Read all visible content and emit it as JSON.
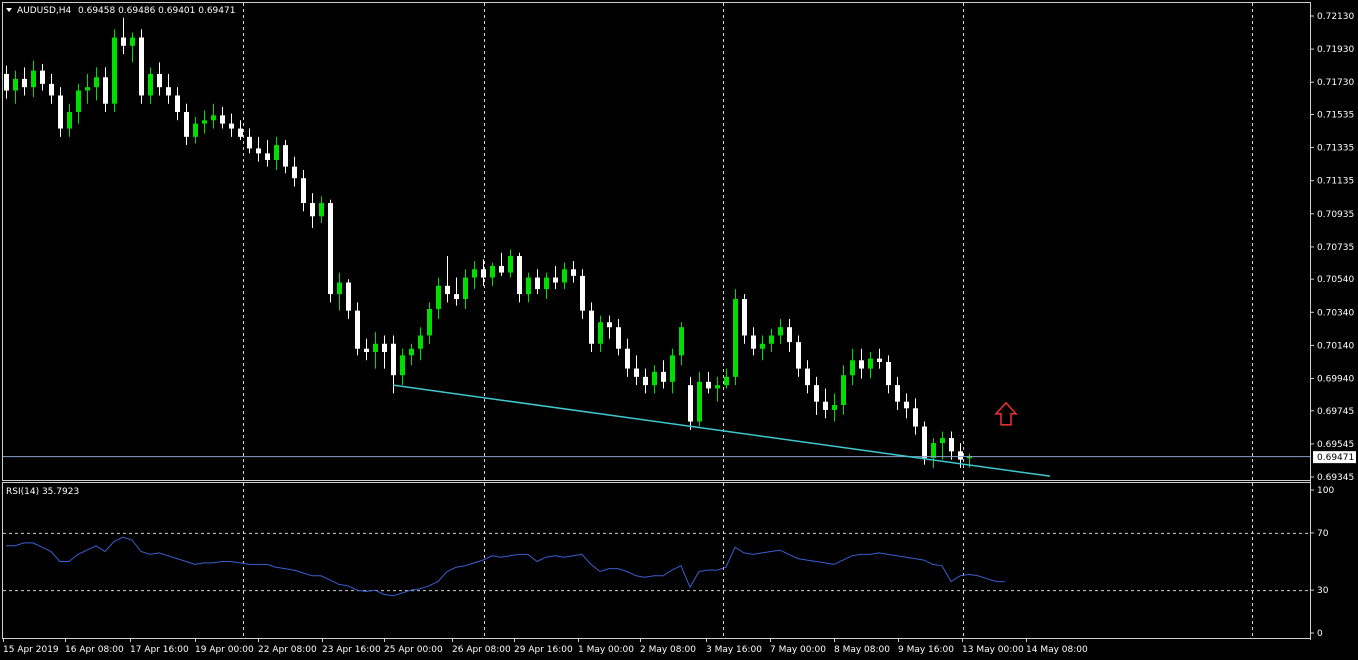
{
  "header": {
    "symbol": "AUDUSD,H4",
    "ohlc": "0.69458 0.69486 0.69401 0.69471"
  },
  "rsi_header": "RSI(14) 35.7923",
  "current_price_label": "0.69471",
  "colors": {
    "background": "#000000",
    "bull": "#00dd00",
    "bear": "#ffffff",
    "grid": "#ffffff",
    "trendline": "#40c8d0",
    "rsi_line": "#3a5fd0",
    "arrow": "#e03030",
    "price_line": "#8aa0c8"
  },
  "icons": {
    "signal_arrow": "up-arrow-icon",
    "collapse": "triangle-down-icon"
  },
  "price_axis_labels": [
    "0.72130",
    "0.71930",
    "0.71730",
    "0.71535",
    "0.71335",
    "0.71135",
    "0.70935",
    "0.70735",
    "0.70540",
    "0.70340",
    "0.70140",
    "0.69940",
    "0.69745",
    "0.69545",
    "0.69345"
  ],
  "rsi_axis_labels": [
    "100",
    "70",
    "30",
    "0"
  ],
  "time_axis_labels": [
    "15 Apr 2019",
    "16 Apr 08:00",
    "17 Apr 16:00",
    "19 Apr 00:00",
    "22 Apr 08:00",
    "23 Apr 16:00",
    "25 Apr 00:00",
    "26 Apr 08:00",
    "29 Apr 16:00",
    "1 May 00:00",
    "2 May 08:00",
    "3 May 16:00",
    "7 May 00:00",
    "8 May 08:00",
    "9 May 16:00",
    "13 May 00:00",
    "14 May 08:00"
  ],
  "chart_data": {
    "type": "candlestick",
    "symbol": "AUDUSD",
    "timeframe": "H4",
    "ylim": [
      0.69345,
      0.7213
    ],
    "current_price": 0.69471,
    "candles": [
      [
        0.7178,
        0.7183,
        0.7163,
        0.7168
      ],
      [
        0.7168,
        0.718,
        0.716,
        0.7175
      ],
      [
        0.7175,
        0.7182,
        0.7165,
        0.717
      ],
      [
        0.717,
        0.7186,
        0.7164,
        0.718
      ],
      [
        0.718,
        0.7184,
        0.7168,
        0.7172
      ],
      [
        0.7172,
        0.7178,
        0.716,
        0.7165
      ],
      [
        0.7165,
        0.717,
        0.714,
        0.7145
      ],
      [
        0.7145,
        0.716,
        0.714,
        0.7155
      ],
      [
        0.7155,
        0.7172,
        0.7148,
        0.7168
      ],
      [
        0.7168,
        0.7178,
        0.716,
        0.717
      ],
      [
        0.717,
        0.7182,
        0.7162,
        0.7176
      ],
      [
        0.7176,
        0.7182,
        0.7155,
        0.716
      ],
      [
        0.716,
        0.7205,
        0.7155,
        0.72
      ],
      [
        0.72,
        0.7212,
        0.719,
        0.7195
      ],
      [
        0.7195,
        0.7203,
        0.7185,
        0.72
      ],
      [
        0.72,
        0.7205,
        0.716,
        0.7165
      ],
      [
        0.7165,
        0.7182,
        0.716,
        0.7178
      ],
      [
        0.7178,
        0.7185,
        0.7165,
        0.717
      ],
      [
        0.717,
        0.7178,
        0.716,
        0.7165
      ],
      [
        0.7165,
        0.717,
        0.715,
        0.7155
      ],
      [
        0.7155,
        0.716,
        0.7135,
        0.714
      ],
      [
        0.714,
        0.7152,
        0.7136,
        0.7148
      ],
      [
        0.7148,
        0.7156,
        0.7142,
        0.715
      ],
      [
        0.715,
        0.716,
        0.7145,
        0.7153
      ],
      [
        0.7153,
        0.7158,
        0.7145,
        0.7148
      ],
      [
        0.7148,
        0.7154,
        0.714,
        0.7145
      ],
      [
        0.7145,
        0.715,
        0.7138,
        0.714
      ],
      [
        0.714,
        0.7145,
        0.713,
        0.7133
      ],
      [
        0.7133,
        0.714,
        0.7125,
        0.713
      ],
      [
        0.713,
        0.7138,
        0.7122,
        0.7126
      ],
      [
        0.7126,
        0.714,
        0.712,
        0.7135
      ],
      [
        0.7135,
        0.7138,
        0.7118,
        0.7122
      ],
      [
        0.7122,
        0.7128,
        0.711,
        0.7115
      ],
      [
        0.7115,
        0.712,
        0.7095,
        0.71
      ],
      [
        0.71,
        0.7106,
        0.7085,
        0.7092
      ],
      [
        0.7092,
        0.7104,
        0.7088,
        0.71
      ],
      [
        0.71,
        0.7102,
        0.704,
        0.7045
      ],
      [
        0.7045,
        0.7058,
        0.7035,
        0.7052
      ],
      [
        0.7052,
        0.7054,
        0.703,
        0.7035
      ],
      [
        0.7035,
        0.704,
        0.7008,
        0.7012
      ],
      [
        0.7012,
        0.7018,
        0.7005,
        0.701
      ],
      [
        0.701,
        0.7022,
        0.7,
        0.7015
      ],
      [
        0.7015,
        0.702,
        0.7,
        0.701
      ],
      [
        0.7015,
        0.702,
        0.6985,
        0.6996
      ],
      [
        0.6996,
        0.7012,
        0.699,
        0.7008
      ],
      [
        0.7008,
        0.7015,
        0.7002,
        0.7012
      ],
      [
        0.7012,
        0.7025,
        0.7005,
        0.702
      ],
      [
        0.702,
        0.704,
        0.7015,
        0.7036
      ],
      [
        0.7036,
        0.7055,
        0.703,
        0.705
      ],
      [
        0.705,
        0.7068,
        0.704,
        0.7045
      ],
      [
        0.7045,
        0.7055,
        0.7038,
        0.7042
      ],
      [
        0.7042,
        0.706,
        0.7036,
        0.7055
      ],
      [
        0.7055,
        0.7065,
        0.7048,
        0.706
      ],
      [
        0.706,
        0.7066,
        0.705,
        0.7055
      ],
      [
        0.7055,
        0.7064,
        0.705,
        0.7062
      ],
      [
        0.7062,
        0.707,
        0.7056,
        0.7058
      ],
      [
        0.7058,
        0.7072,
        0.7055,
        0.7068
      ],
      [
        0.7068,
        0.707,
        0.704,
        0.7045
      ],
      [
        0.7045,
        0.7058,
        0.704,
        0.7055
      ],
      [
        0.7055,
        0.706,
        0.7045,
        0.7048
      ],
      [
        0.7048,
        0.7058,
        0.7042,
        0.7055
      ],
      [
        0.7055,
        0.7062,
        0.7048,
        0.7052
      ],
      [
        0.7052,
        0.7064,
        0.7048,
        0.706
      ],
      [
        0.706,
        0.7065,
        0.7052,
        0.7056
      ],
      [
        0.7056,
        0.706,
        0.703,
        0.7035
      ],
      [
        0.7035,
        0.704,
        0.701,
        0.7015
      ],
      [
        0.7015,
        0.7032,
        0.701,
        0.7028
      ],
      [
        0.7028,
        0.7032,
        0.7018,
        0.7025
      ],
      [
        0.7025,
        0.703,
        0.7008,
        0.7012
      ],
      [
        0.7012,
        0.7018,
        0.6995,
        0.7
      ],
      [
        0.7,
        0.7008,
        0.699,
        0.6995
      ],
      [
        0.6995,
        0.7,
        0.6985,
        0.699
      ],
      [
        0.699,
        0.7002,
        0.6985,
        0.6998
      ],
      [
        0.6998,
        0.7005,
        0.6988,
        0.6992
      ],
      [
        0.6992,
        0.7012,
        0.6985,
        0.7008
      ],
      [
        0.7008,
        0.7028,
        0.7002,
        0.7025
      ],
      [
        0.699,
        0.6995,
        0.6963,
        0.6968
      ],
      [
        0.6968,
        0.6998,
        0.6965,
        0.6992
      ],
      [
        0.6992,
        0.6998,
        0.6985,
        0.6988
      ],
      [
        0.6988,
        0.6995,
        0.698,
        0.699
      ],
      [
        0.699,
        0.7,
        0.6988,
        0.6995
      ],
      [
        0.6995,
        0.7048,
        0.699,
        0.7042
      ],
      [
        0.7042,
        0.7045,
        0.7015,
        0.702
      ],
      [
        0.702,
        0.7025,
        0.7008,
        0.7012
      ],
      [
        0.7012,
        0.702,
        0.7005,
        0.7015
      ],
      [
        0.7015,
        0.7024,
        0.701,
        0.702
      ],
      [
        0.702,
        0.703,
        0.7015,
        0.7025
      ],
      [
        0.7025,
        0.703,
        0.701,
        0.7016
      ],
      [
        0.7016,
        0.702,
        0.6995,
        0.7
      ],
      [
        0.7,
        0.7005,
        0.6985,
        0.699
      ],
      [
        0.699,
        0.6995,
        0.6972,
        0.698
      ],
      [
        0.698,
        0.6988,
        0.697,
        0.6975
      ],
      [
        0.6975,
        0.6985,
        0.6968,
        0.6978
      ],
      [
        0.6978,
        0.7002,
        0.6972,
        0.6996
      ],
      [
        0.6996,
        0.7012,
        0.699,
        0.7005
      ],
      [
        0.7005,
        0.7012,
        0.6994,
        0.7
      ],
      [
        0.7,
        0.701,
        0.6994,
        0.7006
      ],
      [
        0.7006,
        0.7012,
        0.7,
        0.7004
      ],
      [
        0.7004,
        0.7008,
        0.6985,
        0.699
      ],
      [
        0.699,
        0.6995,
        0.6975,
        0.698
      ],
      [
        0.698,
        0.6985,
        0.697,
        0.6976
      ],
      [
        0.6976,
        0.6982,
        0.696,
        0.6965
      ],
      [
        0.6965,
        0.6968,
        0.6942,
        0.6946
      ],
      [
        0.6946,
        0.6958,
        0.694,
        0.6955
      ],
      [
        0.6955,
        0.6962,
        0.6945,
        0.6958
      ],
      [
        0.6958,
        0.6962,
        0.6945,
        0.695
      ],
      [
        0.695,
        0.6955,
        0.694,
        0.6945
      ],
      [
        0.69458,
        0.69486,
        0.69401,
        0.69471
      ]
    ],
    "trendline": {
      "from": {
        "candle_index": 43,
        "price": 0.699
      },
      "to": {
        "candle_index": 116,
        "price": 0.6935
      }
    },
    "signal_arrow": {
      "direction": "up",
      "candle_index": 111,
      "price": 0.696
    },
    "rsi": {
      "name": "RSI(14)",
      "period": 14,
      "last": 35.7923,
      "levels": [
        70,
        30
      ],
      "ylim": [
        0,
        100
      ],
      "values": [
        61,
        61,
        63,
        63,
        60,
        57,
        50,
        50,
        55,
        58,
        61,
        57,
        64,
        67,
        65,
        57,
        55,
        56,
        54,
        52,
        50,
        48,
        49,
        49,
        50,
        50,
        49,
        48,
        48,
        48,
        46,
        45,
        44,
        42,
        40,
        40,
        37,
        34,
        33,
        30,
        29,
        30,
        27,
        26,
        28,
        30,
        31,
        33,
        36,
        43,
        46,
        47,
        49,
        51,
        54,
        53,
        54,
        55,
        55,
        50,
        53,
        54,
        53,
        54,
        55,
        48,
        43,
        45,
        45,
        43,
        40,
        39,
        40,
        40,
        44,
        47,
        32,
        43,
        44,
        44,
        46,
        60,
        56,
        55,
        56,
        57,
        58,
        55,
        52,
        51,
        50,
        49,
        48,
        51,
        54,
        55,
        55,
        56,
        55,
        54,
        53,
        52,
        51,
        48,
        47,
        36,
        40,
        41,
        40,
        38,
        36,
        35.7923
      ]
    }
  }
}
